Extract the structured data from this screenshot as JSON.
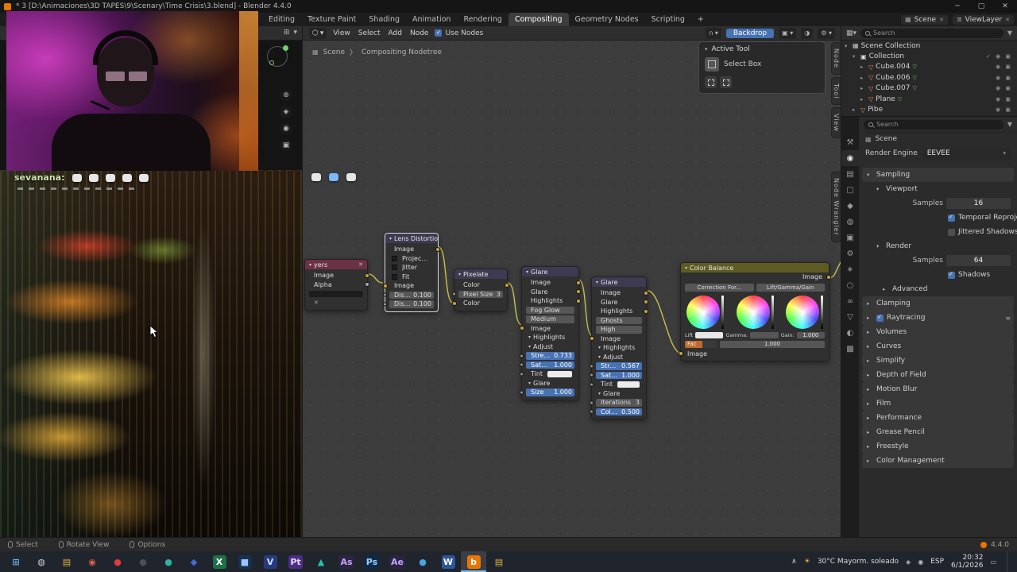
{
  "window": {
    "title": "* 3 [D:\\Animaciones\\3D TAPES\\9\\Scenary\\Time Crisis\\3.blend] - Blender 4.4.0",
    "minimize": "─",
    "maximize": "▢",
    "close": "✕"
  },
  "topbar": {
    "tabs": [
      {
        "label": "Editing",
        "cls": ""
      },
      {
        "label": "Texture Paint",
        "cls": ""
      },
      {
        "label": "Shading",
        "cls": ""
      },
      {
        "label": "Animation",
        "cls": ""
      },
      {
        "label": "Rendering",
        "cls": ""
      },
      {
        "label": "Compositing",
        "cls": "active"
      },
      {
        "label": "Geometry Nodes",
        "cls": ""
      },
      {
        "label": "Scripting",
        "cls": ""
      },
      {
        "label": "+",
        "cls": ""
      }
    ],
    "scene": {
      "icon": "▦",
      "label": "Scene",
      "close": "✕"
    },
    "viewlayer": {
      "icon": "≣",
      "label": "ViewLayer",
      "close": "✕"
    }
  },
  "viewport": {
    "nav": {
      "zoom": "⊕",
      "pan": "◈",
      "camera": "◉",
      "lock": "▣"
    }
  },
  "chat": {
    "user": "sevanana:"
  },
  "node_editor": {
    "menus": [
      "View",
      "Select",
      "Add",
      "Node"
    ],
    "use_nodes": "Use Nodes",
    "backdrop": "Backdrop",
    "snap_icon": "∩",
    "breadcrumb_scene": "Scene",
    "breadcrumb_sep": "〉",
    "breadcrumb_tree": "Compositing Nodetree",
    "sidebar_tabs": [
      "Node",
      "Tool",
      "View",
      "Node Wrangler"
    ]
  },
  "active_tool": {
    "title": "Active Tool",
    "tool": "Select Box"
  },
  "nodes": {
    "render_layers": {
      "title": "yers",
      "header_color": "#6d3146",
      "header_icon": "✕",
      "rows": [
        {
          "cls": "t-out rs-yl",
          "label": "Image"
        },
        {
          "cls": "t-out rs-gy",
          "label": "Alpha"
        },
        {
          "cls": "t-bar",
          "label": ""
        },
        {
          "cls": "t-x",
          "label": "✕"
        }
      ]
    },
    "lens_distortion": {
      "title": "Lens Distortion",
      "header_color": "#3e3a52",
      "rows": [
        {
          "cls": "t-out rs-yl",
          "label": "Image"
        },
        {
          "cls": "t-check",
          "label": "Projector"
        },
        {
          "cls": "t-check",
          "label": "Jitter"
        },
        {
          "cls": "t-check",
          "label": "Fit"
        },
        {
          "cls": "t-in ls-yl",
          "label": "Image"
        },
        {
          "cls": "t-slider ls-gy",
          "label": "Distortion",
          "value": "0.100"
        },
        {
          "cls": "t-slider ls-gy",
          "label": "Dispersion",
          "value": "0.100"
        }
      ]
    },
    "pixelate": {
      "title": "Pixelate",
      "header_color": "#3e3a52",
      "rows": [
        {
          "cls": "t-out rs-yl",
          "label": "Color"
        },
        {
          "cls": "t-slider ls-gy",
          "label": "Pixel Size",
          "value": "3"
        },
        {
          "cls": "t-in ls-yl",
          "label": "Color"
        }
      ]
    },
    "glare1": {
      "title": "Glare",
      "header_color": "#3e3a52",
      "rows": [
        {
          "cls": "t-out rs-yl",
          "label": "Image"
        },
        {
          "cls": "t-out rs-yl",
          "label": "Glare"
        },
        {
          "cls": "t-out rs-yl",
          "label": "Highlights"
        },
        {
          "cls": "t-drop",
          "label": "Fog Glow"
        },
        {
          "cls": "t-drop",
          "label": "Medium"
        },
        {
          "cls": "t-in ls-yl",
          "label": "Image"
        },
        {
          "cls": "t-collapse",
          "arrow": "▾",
          "label": "Highlights"
        },
        {
          "cls": "t-collapse",
          "arrow": "▾",
          "label": "Adjust"
        },
        {
          "cls": "t-blue ls-gy",
          "label": "Strength",
          "value": "0.733"
        },
        {
          "cls": "t-blue ls-gy",
          "label": "Saturation",
          "value": "1.000"
        },
        {
          "cls": "t-swatch ls-gy",
          "label": "Tint"
        },
        {
          "cls": "t-collapse",
          "arrow": "▾",
          "label": "Glare"
        },
        {
          "cls": "t-blue ls-gy",
          "label": "Size",
          "value": "1.000"
        }
      ]
    },
    "glare2": {
      "title": "Glare",
      "header_color": "#3e3a52",
      "rows": [
        {
          "cls": "t-out rs-yl",
          "label": "Image"
        },
        {
          "cls": "t-out rs-yl",
          "label": "Glare"
        },
        {
          "cls": "t-out rs-yl",
          "label": "Highlights"
        },
        {
          "cls": "t-drop",
          "label": "Ghosts"
        },
        {
          "cls": "t-drop",
          "label": "High"
        },
        {
          "cls": "t-in ls-yl",
          "label": "Image"
        },
        {
          "cls": "t-collapse",
          "arrow": "▾",
          "label": "Highlights"
        },
        {
          "cls": "t-collapse",
          "arrow": "▾",
          "label": "Adjust"
        },
        {
          "cls": "t-blue ls-gy",
          "label": "Strength",
          "value": "0.567"
        },
        {
          "cls": "t-blue ls-gy",
          "label": "Saturation",
          "value": "1.000"
        },
        {
          "cls": "t-swatch ls-gy",
          "label": "Tint"
        },
        {
          "cls": "t-collapse",
          "arrow": "▾",
          "label": "Glare"
        },
        {
          "cls": "t-slider ls-gy",
          "label": "Iterations",
          "value": "3"
        },
        {
          "cls": "t-blue ls-gy",
          "label": "Color Modulation",
          "value": "0.500"
        }
      ]
    },
    "color_balance": {
      "title": "Color Balance",
      "header_color": "#5d5a24",
      "out_label": "Image",
      "in_label": "Image",
      "correction": "Correction For...",
      "mode": "Lift/Gamma/Gain",
      "lift_label": "Lift",
      "gamma_label": "Gamma:",
      "gain_label": "Gain:",
      "gain_value": "1.000",
      "fac_label": "Fac",
      "fac_value": "1.000"
    }
  },
  "outliner": {
    "search_placeholder": "Search",
    "items": [
      {
        "pad": 4,
        "arrow": "▾",
        "icon": "▦",
        "ic": "#c8c8c8",
        "label": "Scene Collection",
        "suffix": "",
        "right": ""
      },
      {
        "pad": 14,
        "arrow": "▾",
        "icon": "▣",
        "ic": "#dddddd",
        "label": "Collection",
        "suffix": "",
        "right": "✓ ◉ ▣"
      },
      {
        "pad": 24,
        "arrow": "▸",
        "icon": "▽",
        "ic": "#e8923c",
        "label": "Cube.004",
        "suffix": "▽",
        "right": "◉ ▣"
      },
      {
        "pad": 24,
        "arrow": "▸",
        "icon": "▽",
        "ic": "#e8923c",
        "label": "Cube.006",
        "suffix": "▽",
        "right": "◉ ▣"
      },
      {
        "pad": 24,
        "arrow": "▸",
        "icon": "▽",
        "ic": "#e8923c",
        "label": "Cube.007",
        "suffix": "▽",
        "right": "◉ ▣"
      },
      {
        "pad": 24,
        "arrow": "▸",
        "icon": "▽",
        "ic": "#e8923c",
        "label": "Plane",
        "suffix": "▽",
        "right": "◉ ▣"
      },
      {
        "pad": 14,
        "arrow": "▸",
        "icon": "▽",
        "ic": "#e8923c",
        "label": "Pibe",
        "suffix": "",
        "right": "◉ ▣"
      }
    ]
  },
  "properties": {
    "search_placeholder": "Search",
    "breadcrumb": "Scene",
    "engine_label": "Render Engine",
    "engine_value": "EEVEE",
    "tabs": [
      {
        "g": "⚒",
        "cls": ""
      },
      {
        "g": "◉",
        "cls": "active"
      },
      {
        "g": "▤",
        "cls": ""
      },
      {
        "g": "▢",
        "cls": ""
      },
      {
        "g": "◆",
        "cls": ""
      },
      {
        "g": "◍",
        "cls": ""
      },
      {
        "g": "▣",
        "cls": ""
      },
      {
        "g": "⚙",
        "cls": ""
      },
      {
        "g": "∗",
        "cls": ""
      },
      {
        "g": "○",
        "cls": ""
      },
      {
        "g": "∞",
        "cls": ""
      },
      {
        "g": "▽",
        "cls": ""
      },
      {
        "g": "◐",
        "cls": ""
      },
      {
        "g": "▩",
        "cls": ""
      }
    ],
    "rows": [
      {
        "cls": "p-section",
        "pad": 6,
        "arrow": "▾",
        "label": "Sampling"
      },
      {
        "cls": "p-sub",
        "pad": 18,
        "arrow": "▾",
        "label": "Viewport"
      },
      {
        "cls": "p-field",
        "pad": 8,
        "label": "Samples",
        "value": "16"
      },
      {
        "cls": "p-check on",
        "pad": 96,
        "label": "Temporal Reprojection"
      },
      {
        "cls": "p-check",
        "pad": 96,
        "label": "Jittered Shadows"
      },
      {
        "cls": "p-sub",
        "pad": 18,
        "arrow": "▾",
        "label": "Render"
      },
      {
        "cls": "p-field",
        "pad": 8,
        "label": "Samples",
        "value": "64"
      },
      {
        "cls": "p-check on",
        "pad": 96,
        "label": "Shadows"
      },
      {
        "cls": "p-sub",
        "pad": 26,
        "arrow": "▸",
        "label": "Advanced"
      },
      {
        "cls": "p-section",
        "pad": 6,
        "arrow": "▸",
        "label": "Clamping"
      },
      {
        "cls": "p-section has-chk on has-menu",
        "pad": 6,
        "arrow": "▸",
        "label": "Raytracing",
        "menu": "≡"
      },
      {
        "cls": "p-section",
        "pad": 6,
        "arrow": "▸",
        "label": "Volumes"
      },
      {
        "cls": "p-section",
        "pad": 6,
        "arrow": "▸",
        "label": "Curves"
      },
      {
        "cls": "p-section",
        "pad": 6,
        "arrow": "▸",
        "label": "Simplify"
      },
      {
        "cls": "p-section",
        "pad": 6,
        "arrow": "▸",
        "label": "Depth of Field"
      },
      {
        "cls": "p-section",
        "pad": 6,
        "arrow": "▸",
        "label": "Motion Blur"
      },
      {
        "cls": "p-section",
        "pad": 6,
        "arrow": "▸",
        "label": "Film"
      },
      {
        "cls": "p-section",
        "pad": 6,
        "arrow": "▸",
        "label": "Performance"
      },
      {
        "cls": "p-section",
        "pad": 6,
        "arrow": "▸",
        "label": "Grease Pencil"
      },
      {
        "cls": "p-section",
        "pad": 6,
        "arrow": "▸",
        "label": "Freestyle"
      },
      {
        "cls": "p-section",
        "pad": 6,
        "arrow": "▸",
        "label": "Color Management"
      }
    ]
  },
  "status_bar": {
    "items": [
      "Select",
      "Rotate View",
      "Options"
    ],
    "version": "4.4.0"
  },
  "taskbar": {
    "items": [
      {
        "g": "⊞",
        "fg": "#6db3f2",
        "bg": "",
        "cls": ""
      },
      {
        "g": "◍",
        "fg": "#c9d4de",
        "bg": "",
        "cls": ""
      },
      {
        "g": "▤",
        "fg": "#e3b341",
        "bg": "",
        "cls": ""
      },
      {
        "g": "◉",
        "fg": "#e06050",
        "bg": "",
        "cls": ""
      },
      {
        "g": "●",
        "fg": "#e23b3b",
        "bg": "",
        "cls": ""
      },
      {
        "g": "●",
        "fg": "#4a4f58",
        "bg": "",
        "cls": ""
      },
      {
        "g": "●",
        "fg": "#2bb3a3",
        "bg": "",
        "cls": ""
      },
      {
        "g": "◆",
        "fg": "#3f6fd8",
        "bg": "",
        "cls": ""
      },
      {
        "g": "X",
        "fg": "#ffffff",
        "bg": "#1e7145",
        "cls": ""
      },
      {
        "g": "■",
        "fg": "#9fc3ff",
        "bg": "#16324c",
        "cls": ""
      },
      {
        "g": "V",
        "fg": "#cfe0ff",
        "bg": "#253a80",
        "cls": ""
      },
      {
        "g": "Pt",
        "fg": "#e8d9ff",
        "bg": "#4b2e83",
        "cls": ""
      },
      {
        "g": "▲",
        "fg": "#25c2b2",
        "bg": "",
        "cls": ""
      },
      {
        "g": "As",
        "fg": "#c5a3ff",
        "bg": "#2a2440",
        "cls": ""
      },
      {
        "g": "Ps",
        "fg": "#9fd0ff",
        "bg": "#0d2a47",
        "cls": ""
      },
      {
        "g": "Ae",
        "fg": "#c5a3ff",
        "bg": "#2a2440",
        "cls": ""
      },
      {
        "g": "●",
        "fg": "#4aa3e8",
        "bg": "",
        "cls": ""
      },
      {
        "g": "W",
        "fg": "#ffffff",
        "bg": "#2b579a",
        "cls": ""
      },
      {
        "g": "b",
        "fg": "#ffffff",
        "bg": "#ea7600",
        "cls": "active"
      },
      {
        "g": "▤",
        "fg": "#e3b341",
        "bg": "",
        "cls": ""
      }
    ],
    "tray": {
      "expand": "∧",
      "sun": "☀",
      "weather": "30°C  Mayorm. soleado",
      "lang": "ESP",
      "time": "20:32",
      "date": "6/1/2026"
    }
  },
  "colors": {
    "accent": "#4772b3",
    "socket_yellow": "#c8a53c",
    "noodle": "#cfc84b"
  }
}
